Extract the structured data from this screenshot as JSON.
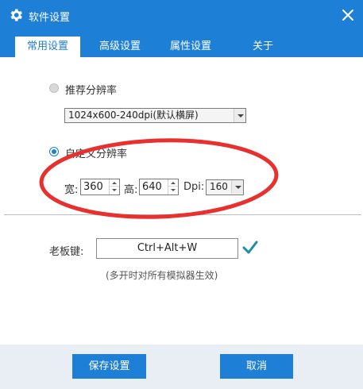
{
  "window": {
    "title": "软件设置"
  },
  "tabs": [
    {
      "label": "常用设置",
      "active": true
    },
    {
      "label": "高级设置",
      "active": false
    },
    {
      "label": "属性设置",
      "active": false
    },
    {
      "label": "关于",
      "active": false
    }
  ],
  "resolution": {
    "recommended_label": "推荐分辨率",
    "recommended_selected": false,
    "preset_value": "1024x600-240dpi(默认横屏)",
    "custom_label": "自定义分辨率",
    "custom_selected": true,
    "width_label": "宽:",
    "width_value": "360",
    "height_label": "高:",
    "height_value": "640",
    "dpi_label": "Dpi:",
    "dpi_value": "160"
  },
  "boss_key": {
    "label": "老板键:",
    "value": "Ctrl+Alt+W",
    "note": "(多开时对所有模拟器生效)"
  },
  "footer": {
    "save_label": "保存设置",
    "cancel_label": "取消"
  },
  "colors": {
    "accent": "#1e7fd6",
    "annotation": "#e8312f",
    "check": "#1a8fa6"
  }
}
